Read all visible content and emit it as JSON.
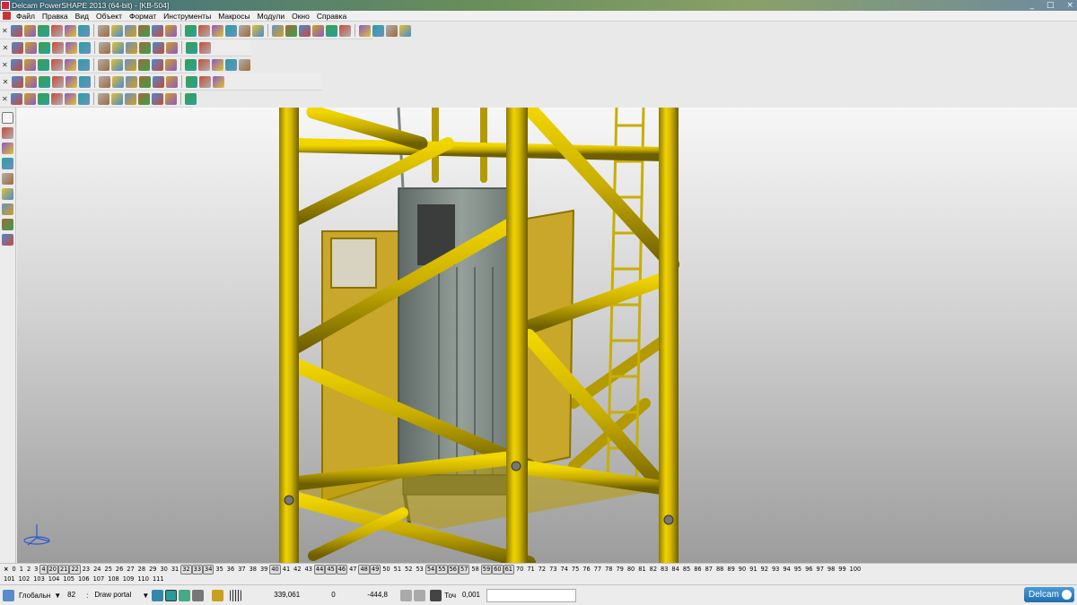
{
  "window": {
    "title": "Delcam PowerSHAPE 2013 (64-bit) - [KB-504]",
    "controls": [
      "_",
      "□",
      "×"
    ]
  },
  "menu": [
    "Файл",
    "Правка",
    "Вид",
    "Объект",
    "Формат",
    "Инструменты",
    "Макросы",
    "Модули",
    "Окно",
    "Справка"
  ],
  "toolbars": [
    {
      "name": "standard",
      "icons": [
        "new-icon",
        "open-icon",
        "save-icon",
        "save-all-icon",
        "print-icon",
        "properties-icon",
        "cut-icon",
        "copy-icon",
        "paste-icon",
        "clear-icon",
        "delete-icon",
        "undo-icon",
        "redo-icon",
        "select-icon",
        "lock-icon",
        "pan-icon",
        "zoom-in-icon",
        "zoom-out-icon",
        "zoom-box-icon",
        "rotate-icon",
        "view-icon",
        "shade-icon",
        "texture-icon",
        "light-icon",
        "measure-icon",
        "analyze-icon",
        "layers-icon",
        "wizard-icon"
      ]
    },
    {
      "name": "views",
      "icons": [
        "view-front-icon",
        "view-back-icon",
        "view-left-icon",
        "view-right-icon",
        "view-top-icon",
        "view-iso-icon",
        "fit-icon",
        "zoom-window-icon",
        "shaded-icon",
        "wire-icon",
        "hidden-icon",
        "material-icon",
        "edges-icon",
        "section-icon"
      ]
    },
    {
      "name": "surfaces",
      "icons": [
        "box-icon",
        "cylinder-icon",
        "cone-icon",
        "sphere-icon",
        "torus-icon",
        "extrusion-icon",
        "revolve-icon",
        "plane-icon",
        "blend-icon",
        "fillet-icon",
        "offset-icon",
        "trim-icon",
        "split-icon",
        "merge-icon",
        "curve-icon",
        "spline-icon",
        "mirror-icon"
      ]
    },
    {
      "name": "solids",
      "icons": [
        "solid-icon",
        "boolean-icon",
        "cut-solid-icon",
        "shell-icon",
        "feature-icon",
        "hole-icon",
        "boss-icon",
        "pocket-icon",
        "rib-icon",
        "chamfer-icon",
        "draft-icon",
        "pattern-icon",
        "wrap-icon",
        "morph-icon",
        "direct-icon"
      ]
    }
  ],
  "sidebar_icons": [
    "select-tool-icon",
    "layers-tool-icon",
    "workplane-icon",
    "curve-tool-icon",
    "surface-tool-icon",
    "solid-tool-icon",
    "mesh-tool-icon",
    "dimension-tool-icon",
    "feature-tool-icon"
  ],
  "level_rows": [
    [
      "0",
      "1",
      "2",
      "3",
      "4",
      "20",
      "21",
      "22",
      "23",
      "24",
      "25",
      "26",
      "27",
      "28",
      "29",
      "30",
      "31",
      "32",
      "33",
      "34",
      "35",
      "36",
      "37",
      "38",
      "39",
      "40",
      "41",
      "42",
      "43",
      "44",
      "45",
      "46",
      "47",
      "48",
      "49",
      "50",
      "51",
      "52",
      "53",
      "54",
      "55",
      "56",
      "57",
      "58",
      "59",
      "60",
      "61",
      "70",
      "71",
      "72",
      "73",
      "74",
      "75",
      "76",
      "77",
      "78",
      "79",
      "80",
      "81",
      "82",
      "83",
      "84",
      "85",
      "86",
      "87",
      "88",
      "89",
      "90",
      "91",
      "92",
      "93",
      "94",
      "95",
      "96",
      "97",
      "98",
      "99",
      "100"
    ],
    [
      "101",
      "102",
      "103",
      "104",
      "105",
      "106",
      "107",
      "108",
      "109",
      "110",
      "111"
    ]
  ],
  "levels_on": [
    "4",
    "20",
    "21",
    "22",
    "32",
    "33",
    "34",
    "40",
    "44",
    "45",
    "46",
    "48",
    "49",
    "54",
    "55",
    "56",
    "57",
    "59",
    "60",
    "61"
  ],
  "status": {
    "workplane": "Глобальн",
    "level_number": "82",
    "level_name": "Draw portal",
    "coord_x": "339,061",
    "coord_y": "0",
    "coord_z": "-444,8",
    "tolerance_label": "Точ",
    "tolerance_value": "0,001"
  },
  "brand": "Delcam",
  "colors": {
    "steel_yellow": "#d4b800",
    "panel_yellow": "#c9a72a",
    "car_gray": "#7f8a85"
  }
}
